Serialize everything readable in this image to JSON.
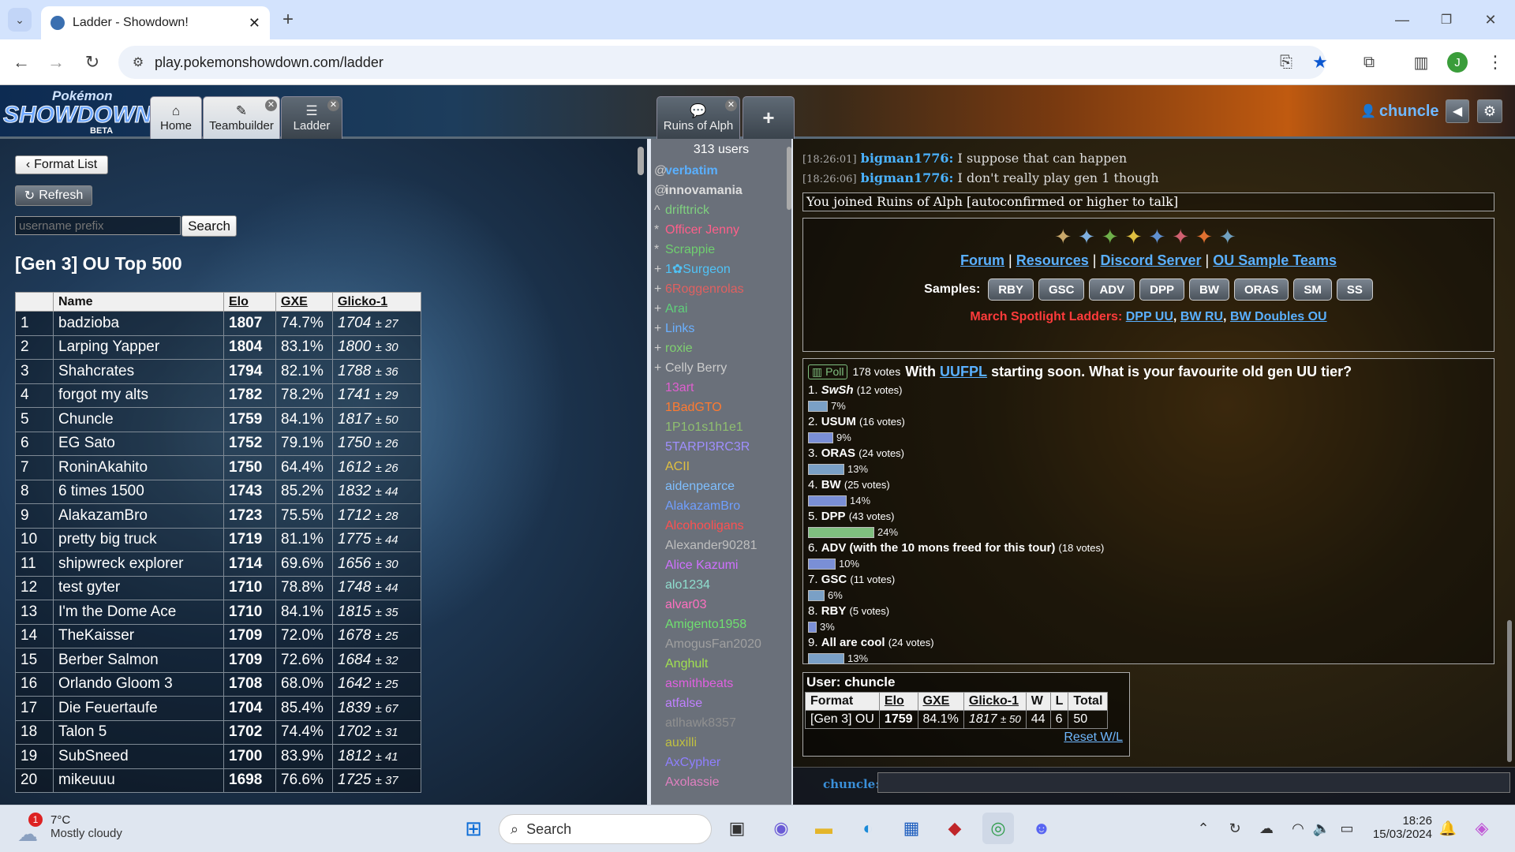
{
  "browser": {
    "tab_title": "Ladder - Showdown!",
    "url": "play.pokemonshowdown.com/ladder",
    "profile_initial": "J"
  },
  "header": {
    "logo_top": "Pokémon",
    "logo_main": "SHOWDOWN",
    "logo_sub": "BETA",
    "tabs": [
      {
        "label": "Home",
        "icon": "home-icon"
      },
      {
        "label": "Teambuilder",
        "icon": "pencil-icon"
      },
      {
        "label": "Ladder",
        "icon": "list-icon"
      }
    ],
    "room_tab": "Ruins of Alph",
    "username": "chuncle"
  },
  "ladder": {
    "format_list_label": "Format List",
    "refresh_label": "Refresh",
    "search_placeholder": "username prefix",
    "search_label": "Search",
    "title": "[Gen 3] OU Top 500",
    "columns": [
      "",
      "Name",
      "Elo",
      "GXE",
      "Glicko-1"
    ],
    "rows": [
      {
        "rank": "1",
        "name": "badzioba",
        "elo": "1807",
        "gxe": "74.7%",
        "g": "1704",
        "dev": "± 27"
      },
      {
        "rank": "2",
        "name": "Larping Yapper",
        "elo": "1804",
        "gxe": "83.1%",
        "g": "1800",
        "dev": "± 30"
      },
      {
        "rank": "3",
        "name": "Shahcrates",
        "elo": "1794",
        "gxe": "82.1%",
        "g": "1788",
        "dev": "± 36"
      },
      {
        "rank": "4",
        "name": "forgot my alts",
        "elo": "1782",
        "gxe": "78.2%",
        "g": "1741",
        "dev": "± 29"
      },
      {
        "rank": "5",
        "name": "Chuncle",
        "elo": "1759",
        "gxe": "84.1%",
        "g": "1817",
        "dev": "± 50"
      },
      {
        "rank": "6",
        "name": "EG Sato",
        "elo": "1752",
        "gxe": "79.1%",
        "g": "1750",
        "dev": "± 26"
      },
      {
        "rank": "7",
        "name": "RoninAkahito",
        "elo": "1750",
        "gxe": "64.4%",
        "g": "1612",
        "dev": "± 26"
      },
      {
        "rank": "8",
        "name": "6 times 1500",
        "elo": "1743",
        "gxe": "85.2%",
        "g": "1832",
        "dev": "± 44"
      },
      {
        "rank": "9",
        "name": "AlakazamBro",
        "elo": "1723",
        "gxe": "75.5%",
        "g": "1712",
        "dev": "± 28"
      },
      {
        "rank": "10",
        "name": "pretty big truck",
        "elo": "1719",
        "gxe": "81.1%",
        "g": "1775",
        "dev": "± 44"
      },
      {
        "rank": "11",
        "name": "shipwreck explorer",
        "elo": "1714",
        "gxe": "69.6%",
        "g": "1656",
        "dev": "± 30"
      },
      {
        "rank": "12",
        "name": "test gyter",
        "elo": "1710",
        "gxe": "78.8%",
        "g": "1748",
        "dev": "± 44"
      },
      {
        "rank": "13",
        "name": "I'm the Dome Ace",
        "elo": "1710",
        "gxe": "84.1%",
        "g": "1815",
        "dev": "± 35"
      },
      {
        "rank": "14",
        "name": "TheKaisser",
        "elo": "1709",
        "gxe": "72.0%",
        "g": "1678",
        "dev": "± 25"
      },
      {
        "rank": "15",
        "name": "Berber Salmon",
        "elo": "1709",
        "gxe": "72.6%",
        "g": "1684",
        "dev": "± 32"
      },
      {
        "rank": "16",
        "name": "Orlando Gloom 3",
        "elo": "1708",
        "gxe": "68.0%",
        "g": "1642",
        "dev": "± 25"
      },
      {
        "rank": "17",
        "name": "Die Feuertaufe",
        "elo": "1704",
        "gxe": "85.4%",
        "g": "1839",
        "dev": "± 67"
      },
      {
        "rank": "18",
        "name": "Talon 5",
        "elo": "1702",
        "gxe": "74.4%",
        "g": "1702",
        "dev": "± 31"
      },
      {
        "rank": "19",
        "name": "SubSneed",
        "elo": "1700",
        "gxe": "83.9%",
        "g": "1812",
        "dev": "± 41"
      },
      {
        "rank": "20",
        "name": "mikeuuu",
        "elo": "1698",
        "gxe": "76.6%",
        "g": "1725",
        "dev": "± 37"
      }
    ]
  },
  "userlist": {
    "count": "313 users",
    "users": [
      {
        "sym": "@",
        "name": "verbatim",
        "color": "#5ab0ff",
        "bold": true
      },
      {
        "sym": "@",
        "name": "innovamania",
        "color": "#dddddd",
        "bold": true
      },
      {
        "sym": "^",
        "name": "drifttrick",
        "color": "#7fd07f",
        "bold": false
      },
      {
        "sym": "*",
        "name": "Officer Jenny",
        "color": "#ff5f8a",
        "bold": false
      },
      {
        "sym": "*",
        "name": "Scrappie",
        "color": "#6fcf6f",
        "bold": false
      },
      {
        "sym": "+",
        "name": "1✿Surgeon",
        "color": "#4fc3f7",
        "bold": false
      },
      {
        "sym": "+",
        "name": "6Roggenrolas",
        "color": "#e06060",
        "bold": false
      },
      {
        "sym": "+",
        "name": "Arai",
        "color": "#5fd07a",
        "bold": false
      },
      {
        "sym": "+",
        "name": "Links",
        "color": "#6ab0ff",
        "bold": false
      },
      {
        "sym": "+",
        "name": "roxie",
        "color": "#7fd06f",
        "bold": false
      },
      {
        "sym": "+",
        "name": "Celly Berry",
        "color": "#cccccc",
        "bold": false
      },
      {
        "sym": "",
        "name": "13art",
        "color": "#e05fd0",
        "bold": false
      },
      {
        "sym": "",
        "name": "1BadGTO",
        "color": "#ff7a30",
        "bold": false
      },
      {
        "sym": "",
        "name": "1P1o1s1h1e1",
        "color": "#8fbf6f",
        "bold": false
      },
      {
        "sym": "",
        "name": "5TARPI3RC3R",
        "color": "#9f8fff",
        "bold": false
      },
      {
        "sym": "",
        "name": "ACII",
        "color": "#e0c040",
        "bold": false
      },
      {
        "sym": "",
        "name": "aidenpearce",
        "color": "#7fbfff",
        "bold": false
      },
      {
        "sym": "",
        "name": "AlakazamBro",
        "color": "#6f9fff",
        "bold": false
      },
      {
        "sym": "",
        "name": "Alcohooligans",
        "color": "#ff5050",
        "bold": false
      },
      {
        "sym": "",
        "name": "Alexander90281",
        "color": "#bfbfbf",
        "bold": false
      },
      {
        "sym": "",
        "name": "Alice Kazumi",
        "color": "#d070ff",
        "bold": false
      },
      {
        "sym": "",
        "name": "alo1234",
        "color": "#8fdfcf",
        "bold": false
      },
      {
        "sym": "",
        "name": "alvar03",
        "color": "#ff70c0",
        "bold": false
      },
      {
        "sym": "",
        "name": "Amigento1958",
        "color": "#6fe06f",
        "bold": false
      },
      {
        "sym": "",
        "name": "AmogusFan2020",
        "color": "#a0a0a0",
        "bold": false
      },
      {
        "sym": "",
        "name": "Anghult",
        "color": "#a0e050",
        "bold": false
      },
      {
        "sym": "",
        "name": "asmithbeats",
        "color": "#e060e0",
        "bold": false
      },
      {
        "sym": "",
        "name": "atfalse",
        "color": "#c080ff",
        "bold": false
      },
      {
        "sym": "",
        "name": "atlhawk8357",
        "color": "#909090",
        "bold": false
      },
      {
        "sym": "",
        "name": "auxilli",
        "color": "#c0c040",
        "bold": false
      },
      {
        "sym": "",
        "name": "AxCypher",
        "color": "#8f7fff",
        "bold": false
      },
      {
        "sym": "",
        "name": "Axolassie",
        "color": "#e080c0",
        "bold": false
      }
    ]
  },
  "chat": {
    "lines": [
      {
        "ts": "[18:26:01]",
        "name": "bigman1776:",
        "text": "I suppose that can happen"
      },
      {
        "ts": "[18:26:06]",
        "name": "bigman1776:",
        "text": "I don't really play gen 1 though"
      }
    ],
    "joined_notice": "You joined Ruins of Alph [autoconfirmed or higher to talk]",
    "links": [
      "Forum",
      "Resources",
      "Discord Server",
      "OU Sample Teams"
    ],
    "samples_label": "Samples:",
    "samples": [
      "RBY",
      "GSC",
      "ADV",
      "DPP",
      "BW",
      "ORAS",
      "SM",
      "SS"
    ],
    "spotlight_label": "March Spotlight Ladders:",
    "spotlight": [
      "DPP UU",
      "BW RU",
      "BW Doubles OU"
    ],
    "input_name": "chuncle:"
  },
  "poll": {
    "badge": "Poll",
    "votes": "178 votes",
    "q_pre": "With",
    "q_link": "UUFPL",
    "q_post": "starting soon. What is your favourite old gen UU tier?",
    "options": [
      {
        "label": "1.",
        "name": "SwSh",
        "votes": "(12 votes)",
        "pct": "7%",
        "v": 7,
        "italic": true
      },
      {
        "label": "2.",
        "name": "USUM",
        "votes": "(16 votes)",
        "pct": "9%",
        "v": 9,
        "italic": false
      },
      {
        "label": "3.",
        "name": "ORAS",
        "votes": "(24 votes)",
        "pct": "13%",
        "v": 13,
        "italic": false
      },
      {
        "label": "4.",
        "name": "BW",
        "votes": "(25 votes)",
        "pct": "14%",
        "v": 14,
        "italic": false
      },
      {
        "label": "5.",
        "name": "DPP",
        "votes": "(43 votes)",
        "pct": "24%",
        "v": 24,
        "italic": false
      },
      {
        "label": "6.",
        "name": "ADV (with the 10 mons freed for this tour)",
        "votes": "(18 votes)",
        "pct": "10%",
        "v": 10,
        "italic": false
      },
      {
        "label": "7.",
        "name": "GSC",
        "votes": "(11 votes)",
        "pct": "6%",
        "v": 6,
        "italic": false
      },
      {
        "label": "8.",
        "name": "RBY",
        "votes": "(5 votes)",
        "pct": "3%",
        "v": 3,
        "italic": false
      },
      {
        "label": "9.",
        "name": "All are cool",
        "votes": "(24 votes)",
        "pct": "13%",
        "v": 13,
        "italic": false
      }
    ]
  },
  "userstats": {
    "user_label": "User:",
    "user": "chuncle",
    "headers": [
      "Format",
      "Elo",
      "GXE",
      "Glicko-1",
      "W",
      "L",
      "Total"
    ],
    "row": {
      "format": "[Gen 3] OU",
      "elo": "1759",
      "gxe": "84.1%",
      "g": "1817",
      "dev": "± 50",
      "w": "44",
      "l": "6",
      "total": "50"
    },
    "reset": "Reset W/L"
  },
  "taskbar": {
    "weather_temp": "7°C",
    "weather_desc": "Mostly cloudy",
    "weather_badge": "1",
    "search": "Search",
    "time": "18:26",
    "date": "15/03/2024"
  }
}
